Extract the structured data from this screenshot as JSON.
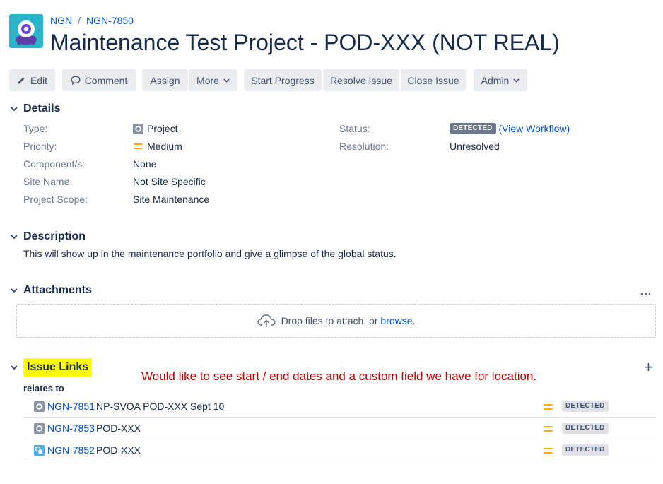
{
  "breadcrumb": {
    "project": "NGN",
    "separator": "/",
    "issue_key": "NGN-7850"
  },
  "issue": {
    "title": "Maintenance Test Project - POD-XXX (NOT REAL)"
  },
  "toolbar": {
    "edit": "Edit",
    "comment": "Comment",
    "assign": "Assign",
    "more": "More",
    "start_progress": "Start Progress",
    "resolve_issue": "Resolve Issue",
    "close_issue": "Close Issue",
    "admin": "Admin"
  },
  "details": {
    "heading": "Details",
    "type_label": "Type:",
    "type_value": "Project",
    "priority_label": "Priority:",
    "priority_value": "Medium",
    "component_label": "Component/s:",
    "component_value": "None",
    "site_label": "Site Name:",
    "site_value": "Not Site Specific",
    "scope_label": "Project Scope:",
    "scope_value": "Site Maintenance",
    "status_label": "Status:",
    "status_value": "DETECTED",
    "view_workflow_open": "(",
    "view_workflow": "View Workflow",
    "view_workflow_close": ")",
    "resolution_label": "Resolution:",
    "resolution_value": "Unresolved"
  },
  "description": {
    "heading": "Description",
    "text": "This will show up in the maintenance portfolio and give a glimpse of the global status."
  },
  "attachments": {
    "heading": "Attachments",
    "more": "...",
    "drop_text": "Drop files to attach, or ",
    "browse": "browse",
    "drop_end": "."
  },
  "issue_links": {
    "heading": "Issue Links",
    "add": "+",
    "annotation": "Would like to see start / end dates and a custom field we have for location.",
    "relates_to": "relates to",
    "links": [
      {
        "key": "NGN-7851",
        "summary": "NP-SVOA POD-XXX Sept 10",
        "status": "DETECTED",
        "icon": "project-icon"
      },
      {
        "key": "NGN-7853",
        "summary": "POD-XXX",
        "status": "DETECTED",
        "icon": "project-icon"
      },
      {
        "key": "NGN-7852",
        "summary": "POD-XXX",
        "status": "DETECTED",
        "icon": "subtask-icon"
      }
    ]
  },
  "colors": {
    "link": "#0052cc",
    "text": "#172b4d",
    "muted": "#6b778c",
    "button_bg": "#ebecf0",
    "priority_medium": "#ffab00",
    "annotation": "#c00000",
    "highlight": "#ffff00",
    "avatar": "#2bb4c9"
  }
}
